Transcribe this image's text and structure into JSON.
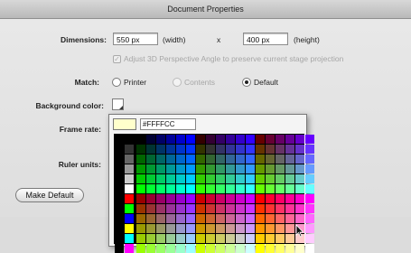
{
  "window": {
    "title": "Document Properties"
  },
  "dimensions": {
    "label": "Dimensions:",
    "width_value": "550 px",
    "width_unit": "(width)",
    "separator": "x",
    "height_value": "400 px",
    "height_unit": "(height)",
    "adjust_3d_label": "Adjust 3D Perspective Angle to preserve current stage projection"
  },
  "match": {
    "label": "Match:",
    "options": [
      "Printer",
      "Contents",
      "Default"
    ],
    "selected": "Default"
  },
  "background_color": {
    "label": "Background color:",
    "value": "#FFFFFF"
  },
  "frame_rate": {
    "label": "Frame rate:"
  },
  "ruler_units": {
    "label": "Ruler units:"
  },
  "buttons": {
    "make_default": "Make Default"
  },
  "color_picker": {
    "hex_value": "#FFFFCC",
    "preview_color": "#FFFFCC"
  },
  "colors": {
    "title_bar": "#c8c8c8",
    "dialog_bg": "#e4e4e4",
    "accent_blue": "#2d7fd0"
  }
}
